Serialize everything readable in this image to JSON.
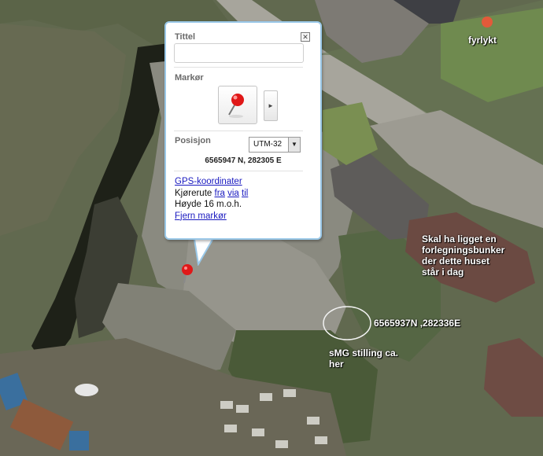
{
  "map": {
    "labels": {
      "lighthouse": "fyrlykt",
      "bunker_note": [
        "Skal ha ligget en",
        "forlegningsbunker",
        "der dette huset",
        "står i dag"
      ],
      "coordinate_note": "6565937N ,282336E",
      "smg_note": [
        "sMG stilling ca.",
        "her"
      ]
    }
  },
  "popup": {
    "title_label": "Tittel",
    "title_value": "",
    "marker_label": "Markør",
    "position_label": "Posisjon",
    "coord_system": "UTM-32",
    "coordinates": "6565947 N,  282305 E",
    "gps_link": "GPS-koordinater",
    "route_prefix": "Kjørerute",
    "route_from": "fra",
    "route_via": "via",
    "route_to": "til",
    "height": "Høyde 16 m.o.h.",
    "remove_marker": "Fjern markør"
  },
  "colors": {
    "popup_border": "#9ac8e8",
    "link": "#1a1ac0",
    "marker": "#e01818"
  }
}
